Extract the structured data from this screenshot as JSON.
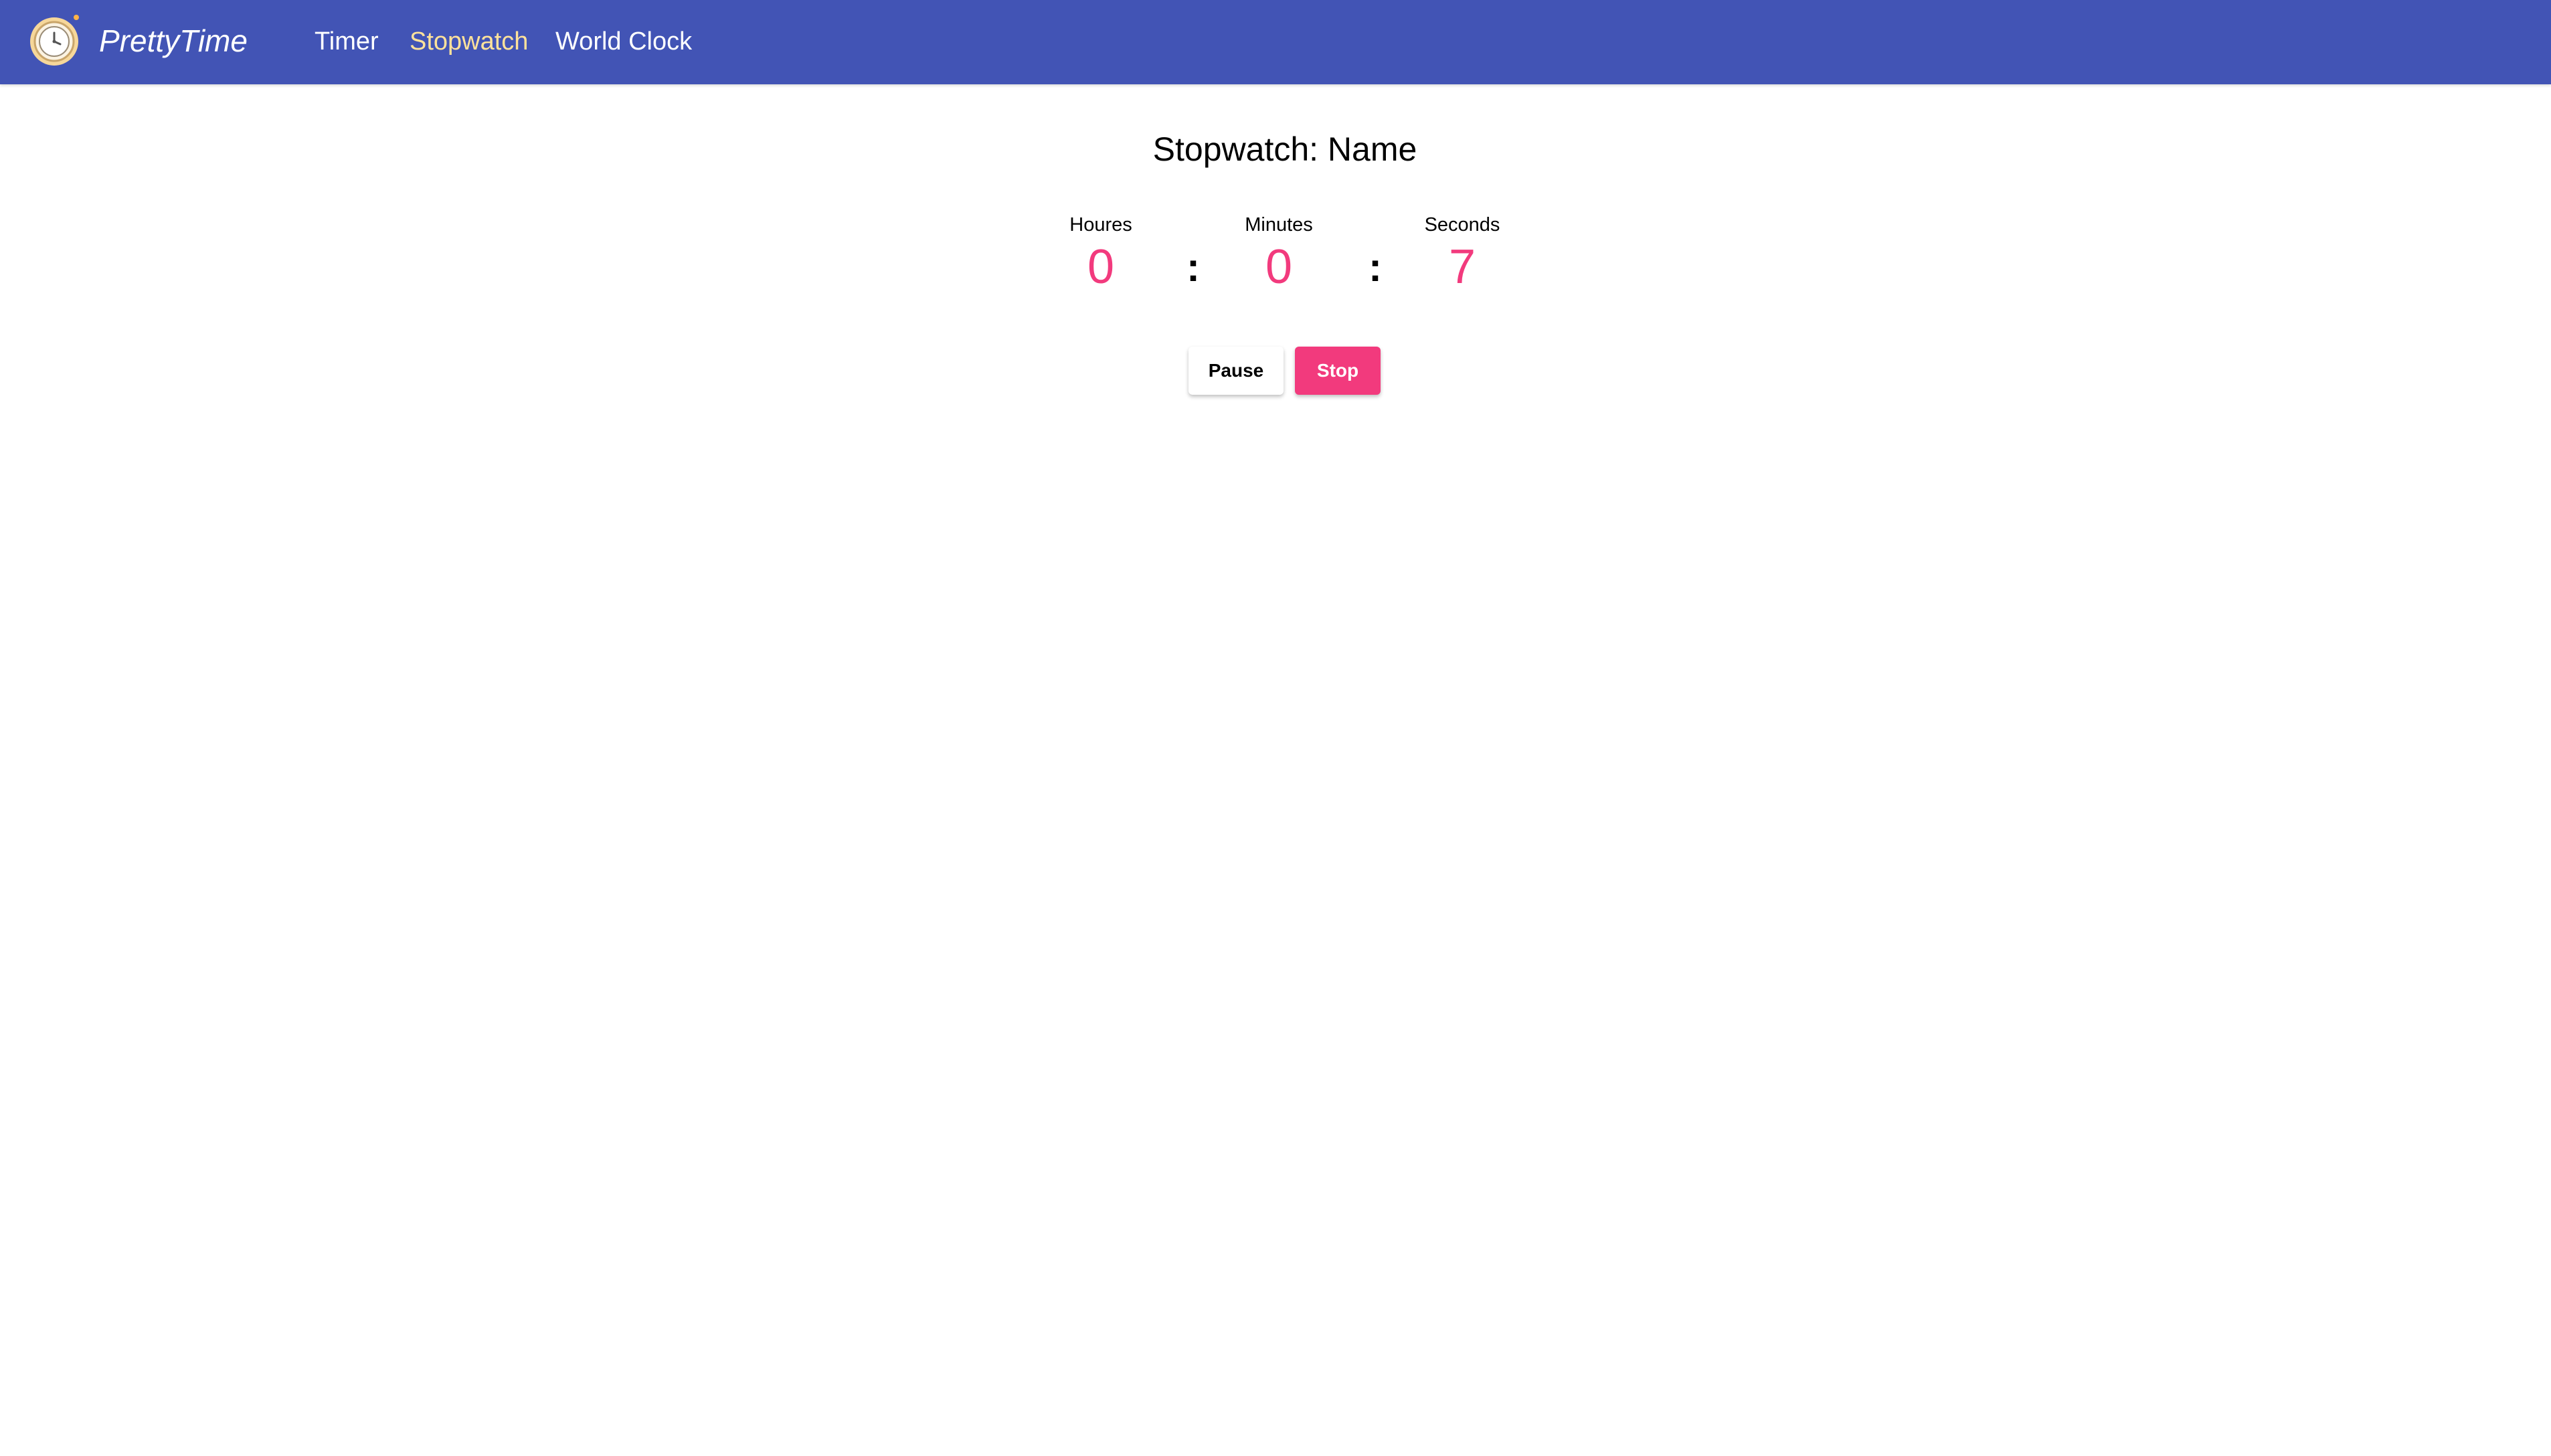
{
  "navbar": {
    "brand": "PrettyTime",
    "links": [
      {
        "label": "Timer",
        "active": false
      },
      {
        "label": "Stopwatch",
        "active": true
      },
      {
        "label": "World Clock",
        "active": false
      }
    ],
    "logo_icon": "stopwatch-icon",
    "colors": {
      "background": "#4254b5",
      "active_link": "#ffe29b"
    }
  },
  "stopwatch": {
    "title": "Stopwatch: Name",
    "hours_label": "Houres",
    "hours_value": "0",
    "minutes_label": "Minutes",
    "minutes_value": "0",
    "seconds_label": "Seconds",
    "seconds_value": "7",
    "separator": ":",
    "value_color": "#f23a7d"
  },
  "actions": {
    "pause_label": "Pause",
    "stop_label": "Stop",
    "stop_color": "#f23a7d"
  }
}
